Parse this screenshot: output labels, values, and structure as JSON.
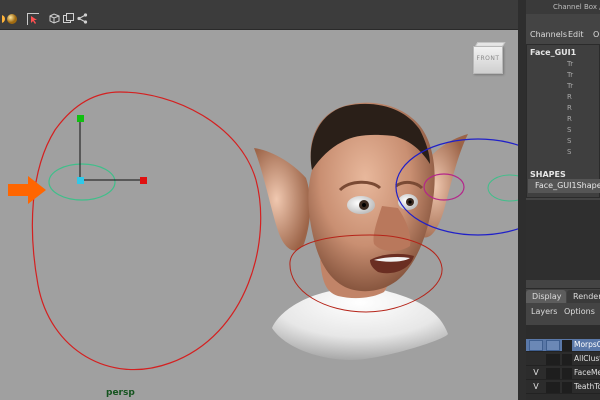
{
  "viewport": {
    "camera_label": "persp",
    "viewcube_label": "FRONT",
    "background": "#a0a0a0"
  },
  "channel_box": {
    "panel_title": "Channel Box / L",
    "menu": [
      "Channels",
      "Edit",
      "Ol"
    ],
    "object_name": "Face_GUI1",
    "attribute_rows": [
      "Tr",
      "Tr",
      "Tr",
      "R",
      "R",
      "R",
      "S",
      "S",
      "S"
    ],
    "shapes_header": "SHAPES",
    "shape_name": "Face_GUI1Shape"
  },
  "layer_editor": {
    "tabs": [
      "Display",
      "Render"
    ],
    "active_tab": "Display",
    "menu": [
      "Layers",
      "Options"
    ],
    "layers": [
      {
        "visible": "",
        "name": "MorpsC",
        "selected": true
      },
      {
        "visible": "",
        "name": "AllClust",
        "selected": false
      },
      {
        "visible": "V",
        "name": "FaceMe",
        "selected": false
      },
      {
        "visible": "V",
        "name": "TeathTo",
        "selected": false
      }
    ]
  },
  "toolbar": {
    "icons": [
      "sphere-icon",
      "select-icon",
      "cube-icon",
      "group-icon",
      "share-icon"
    ]
  },
  "colors": {
    "arrow": "#ff6600",
    "face_curve": "#d42020",
    "eye_ring": "#2020c8",
    "green_ring": "#3fbf8a",
    "axis_y": "#10c010",
    "axis_x": "#e01010",
    "pivot": "#30c8e8",
    "selected_layer": "#5a78a8"
  }
}
